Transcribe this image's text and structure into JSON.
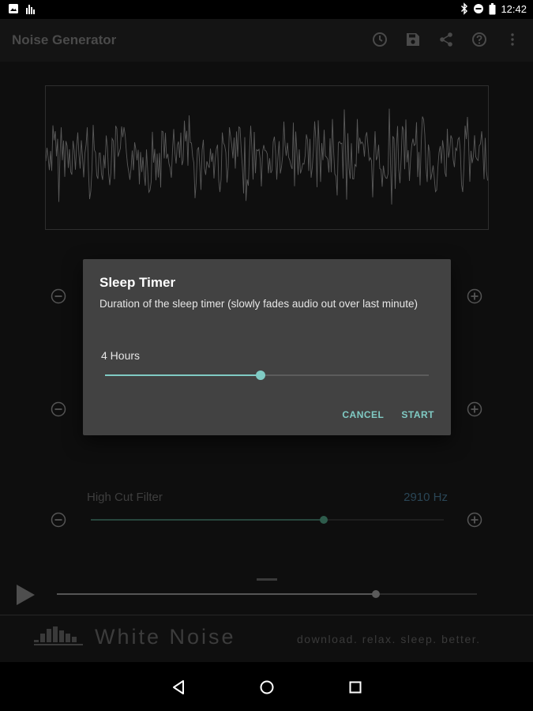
{
  "status_bar": {
    "time": "12:42",
    "left_icons": [
      "image-notification-icon",
      "equalizer-notification-icon"
    ],
    "right_icons": [
      "bluetooth-icon",
      "do-not-disturb-icon",
      "battery-icon"
    ]
  },
  "toolbar": {
    "title": "Noise Generator",
    "actions": [
      "timer-icon",
      "save-icon",
      "share-icon",
      "help-icon",
      "more-vert-icon"
    ]
  },
  "filter": {
    "label": "High Cut Filter",
    "value": "2910 Hz",
    "level": 0.66
  },
  "playback": {
    "progress": 0.76
  },
  "banner": {
    "title": "White Noise",
    "tagline": "download. relax. sleep. better."
  },
  "dialog": {
    "title": "Sleep Timer",
    "message": "Duration of the sleep timer (slowly fades audio out over last minute)",
    "value_label": "4 Hours",
    "level": 0.48,
    "cancel_label": "CANCEL",
    "start_label": "START"
  },
  "colors": {
    "accent": "#80cbc4",
    "dialog_bg": "#424242",
    "page_bg": "#0d0d0d"
  }
}
